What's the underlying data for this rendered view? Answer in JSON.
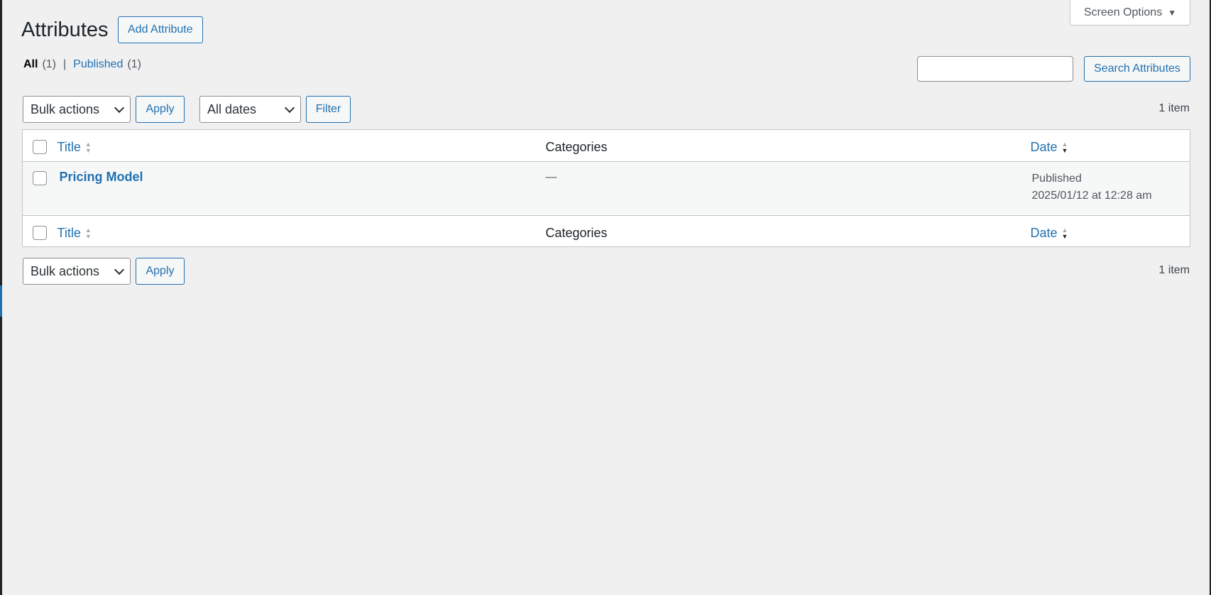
{
  "screen_options": {
    "label": "Screen Options"
  },
  "page": {
    "title": "Attributes",
    "add_button": "Add Attribute"
  },
  "views": {
    "all": {
      "label": "All",
      "count": "(1)"
    },
    "separator": "|",
    "published": {
      "label": "Published",
      "count": "(1)"
    }
  },
  "search": {
    "value": "",
    "button": "Search Attributes"
  },
  "tablenav_top": {
    "bulk_actions": "Bulk actions",
    "apply": "Apply",
    "dates": "All dates",
    "filter": "Filter",
    "items": "1 item"
  },
  "table": {
    "columns": {
      "title": "Title",
      "categories": "Categories",
      "date": "Date"
    },
    "rows": [
      {
        "title": "Pricing Model",
        "categories": "—",
        "status": "Published",
        "date": "2025/01/12 at 12:28 am"
      }
    ]
  },
  "tablenav_bottom": {
    "bulk_actions": "Bulk actions",
    "apply": "Apply",
    "items": "1 item"
  },
  "colors": {
    "accent": "#2271b1",
    "background": "#f0f0f1",
    "text": "#1d2327"
  }
}
